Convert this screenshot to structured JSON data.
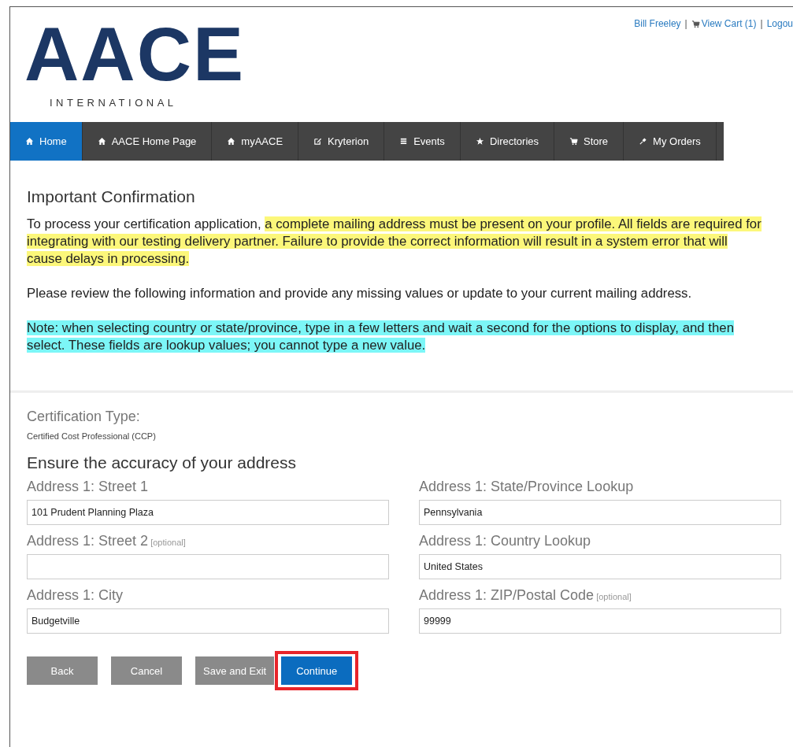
{
  "user_links": [
    {
      "text": "Bill Freeley",
      "kind": "link"
    },
    {
      "text": "|",
      "kind": "separator"
    },
    {
      "text": "View Cart (1)",
      "kind": "cart"
    },
    {
      "text": "|",
      "kind": "separator"
    },
    {
      "text": "Logou",
      "kind": "link"
    }
  ],
  "logo": {
    "wordmark": "AACE",
    "subtitle": "INTERNATIONAL"
  },
  "nav": [
    {
      "label": "Home",
      "kind": "home",
      "selected": true
    },
    {
      "label": "AACE Home Page",
      "kind": "home",
      "selected": false
    },
    {
      "label": "myAACE",
      "kind": "home",
      "selected": false
    },
    {
      "label": "Kryterion",
      "kind": "edit",
      "selected": false
    },
    {
      "label": "Events",
      "kind": "list",
      "selected": false
    },
    {
      "label": "Directories",
      "kind": "star",
      "selected": false
    },
    {
      "label": "Store",
      "kind": "cart",
      "selected": false
    },
    {
      "label": "My Orders",
      "kind": "pin",
      "selected": false
    }
  ],
  "notice": {
    "title": "Important Confirmation",
    "paragraphs": [
      [
        {
          "text": "To process your certification application, ",
          "kind": "plain"
        },
        {
          "text": "a complete mailing address must be present on your profile. All fields are required for integrating with our testing delivery partner. Failure to provide the correct information will result in a system error that will cause delays in processing.",
          "kind": "warning"
        }
      ],
      [
        {
          "text": "Please review the following information and provide any missing values or update to your current mailing address.",
          "kind": "plain"
        }
      ],
      [
        {
          "text": "Note: when selecting country or state/province, type in a few letters and wait a second for the options to display, and then select. These fields are lookup values; you cannot type a new value.",
          "kind": "note"
        }
      ]
    ]
  },
  "certification": {
    "label": "Certification Type:",
    "value": "Certified Cost Professional (CCP)"
  },
  "address_heading": "Ensure the accuracy of your address",
  "fields": [
    {
      "label": "Address 1: Street 1",
      "value": "101 Prudent Planning Plaza"
    },
    {
      "label": "Address 1: State/Province Lookup",
      "value": "Pennsylvania"
    },
    {
      "label": "Address 1: Street 2",
      "optional_tag": "[optional]"
    },
    {
      "label": "Address 1: Country Lookup",
      "value": "United States"
    },
    {
      "label": "Address 1: City",
      "value": "Budgetville"
    },
    {
      "label": "Address 1: ZIP/Postal Code",
      "optional_tag": "[optional]",
      "value": "99999"
    }
  ],
  "buttons": [
    {
      "label": "Back",
      "kind": "secondary",
      "emphasized": false
    },
    {
      "label": "Cancel",
      "kind": "secondary",
      "emphasized": false
    },
    {
      "label": "Save and Exit",
      "kind": "secondary",
      "emphasized": false
    },
    {
      "label": "Continue",
      "kind": "primary",
      "emphasized": true
    }
  ]
}
